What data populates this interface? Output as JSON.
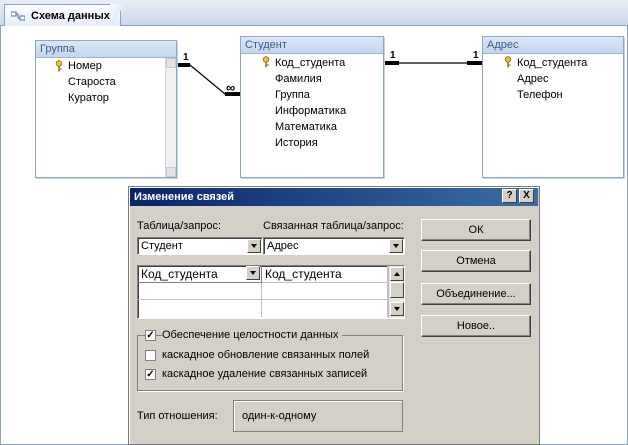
{
  "tab": {
    "title": "Схема данных",
    "icon": "relationships-icon"
  },
  "tables": [
    {
      "title": "Группа",
      "fields": [
        "Номер",
        "Староста",
        "Куратор"
      ]
    },
    {
      "title": "Студент",
      "fields": [
        "Код_студента",
        "Фамилия",
        "Группа",
        "Информатика",
        "Математика",
        "История"
      ]
    },
    {
      "title": "Адрес",
      "fields": [
        "Код_студента",
        "Адрес",
        "Телефон"
      ]
    }
  ],
  "relations": [
    {
      "one": "1",
      "many": "∞"
    },
    {
      "one_left": "1",
      "one_right": "1"
    }
  ],
  "dialog": {
    "title": "Изменение связей",
    "help_btn": "?",
    "close_btn": "X",
    "table_label": "Таблица/запрос:",
    "related_label": "Связанная таблица/запрос:",
    "table_value": "Студент",
    "related_value": "Адрес",
    "grid": {
      "left_field": "Код_студента",
      "right_field": "Код_студента"
    },
    "buttons": {
      "ok": "ОК",
      "cancel": "Отмена",
      "join": "Объединение...",
      "new": "Новое.."
    },
    "checkboxes": [
      {
        "label": "Обеспечение целостности данных",
        "checked": true
      },
      {
        "label": "каскадное обновление связанных полей",
        "checked": false
      },
      {
        "label": "каскадное удаление связанных записей",
        "checked": true
      }
    ],
    "relation_type_label": "Тип отношения:",
    "relation_type_value": "один-к-одному"
  }
}
